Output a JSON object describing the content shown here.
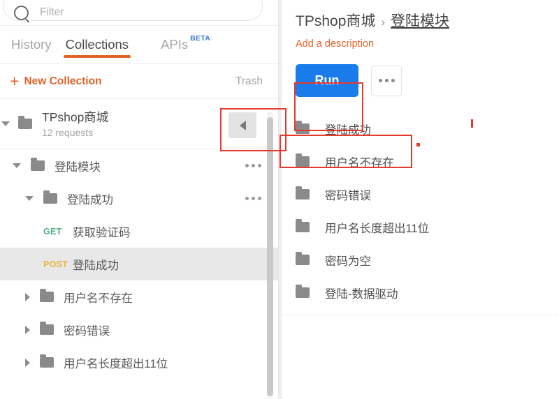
{
  "search": {
    "placeholder": "Filter",
    "value": "",
    "icon": "search-icon"
  },
  "tabs": [
    {
      "label": "History",
      "active": false
    },
    {
      "label": "Collections",
      "active": true
    },
    {
      "label": "APIs",
      "active": false,
      "badge": "BETA"
    }
  ],
  "toolbar": {
    "new_collection_label": "New Collection",
    "new_collection_icon": "plus-icon",
    "trash_label": "Trash"
  },
  "collection": {
    "title": "TPshop商城",
    "subtitle": "12 requests",
    "icon": "folder-open-icon",
    "caret": "caret-down-icon",
    "menu_icon": "more-horizontal-icon"
  },
  "tree": [
    {
      "label": "登陆模块",
      "type": "folder",
      "depth": 1,
      "expanded": true,
      "menu": true
    },
    {
      "label": "登陆成功",
      "type": "folder",
      "depth": 2,
      "expanded": true,
      "menu": true
    },
    {
      "label": "获取验证码",
      "type": "request",
      "method": "GET",
      "depth": 3,
      "selected": false
    },
    {
      "label": "登陆成功",
      "type": "request",
      "method": "POST",
      "depth": 3,
      "selected": true
    },
    {
      "label": "用户名不存在",
      "type": "folder",
      "depth": 2,
      "expanded": false,
      "menu": false
    },
    {
      "label": "密码错误",
      "type": "folder",
      "depth": 2,
      "expanded": false,
      "menu": false
    },
    {
      "label": "用户名长度超出11位",
      "type": "folder",
      "depth": 2,
      "expanded": false,
      "menu": false
    }
  ],
  "sidebar_controls": {
    "collapse_label": "",
    "collapse_icon": "chevron-left-icon",
    "scrollbar": "vertical-scrollbar"
  },
  "main": {
    "breadcrumb": {
      "root": "TPshop商城",
      "separator": "›",
      "current": "登陆模块"
    },
    "description_link": "Add a description",
    "run_button": "Run",
    "more_button_icon": "more-horizontal-icon",
    "folders": [
      {
        "label": "登陆成功",
        "icon": "folder-icon",
        "highlighted": true
      },
      {
        "label": "用户名不存在",
        "icon": "folder-icon",
        "highlighted": false
      },
      {
        "label": "密码错误",
        "icon": "folder-icon",
        "highlighted": false
      },
      {
        "label": "用户名长度超出11位",
        "icon": "folder-icon",
        "highlighted": false
      },
      {
        "label": "密码为空",
        "icon": "folder-icon",
        "highlighted": false
      },
      {
        "label": "登陆-数据驱动",
        "icon": "folder-icon",
        "highlighted": false
      }
    ]
  },
  "colors": {
    "accent_orange": "#e2632c",
    "run_blue": "#1a7ceb",
    "annotation_red": "#e8392f",
    "method_get": "#4caf84",
    "method_post": "#edb339",
    "beta_blue": "#3b76d0"
  }
}
